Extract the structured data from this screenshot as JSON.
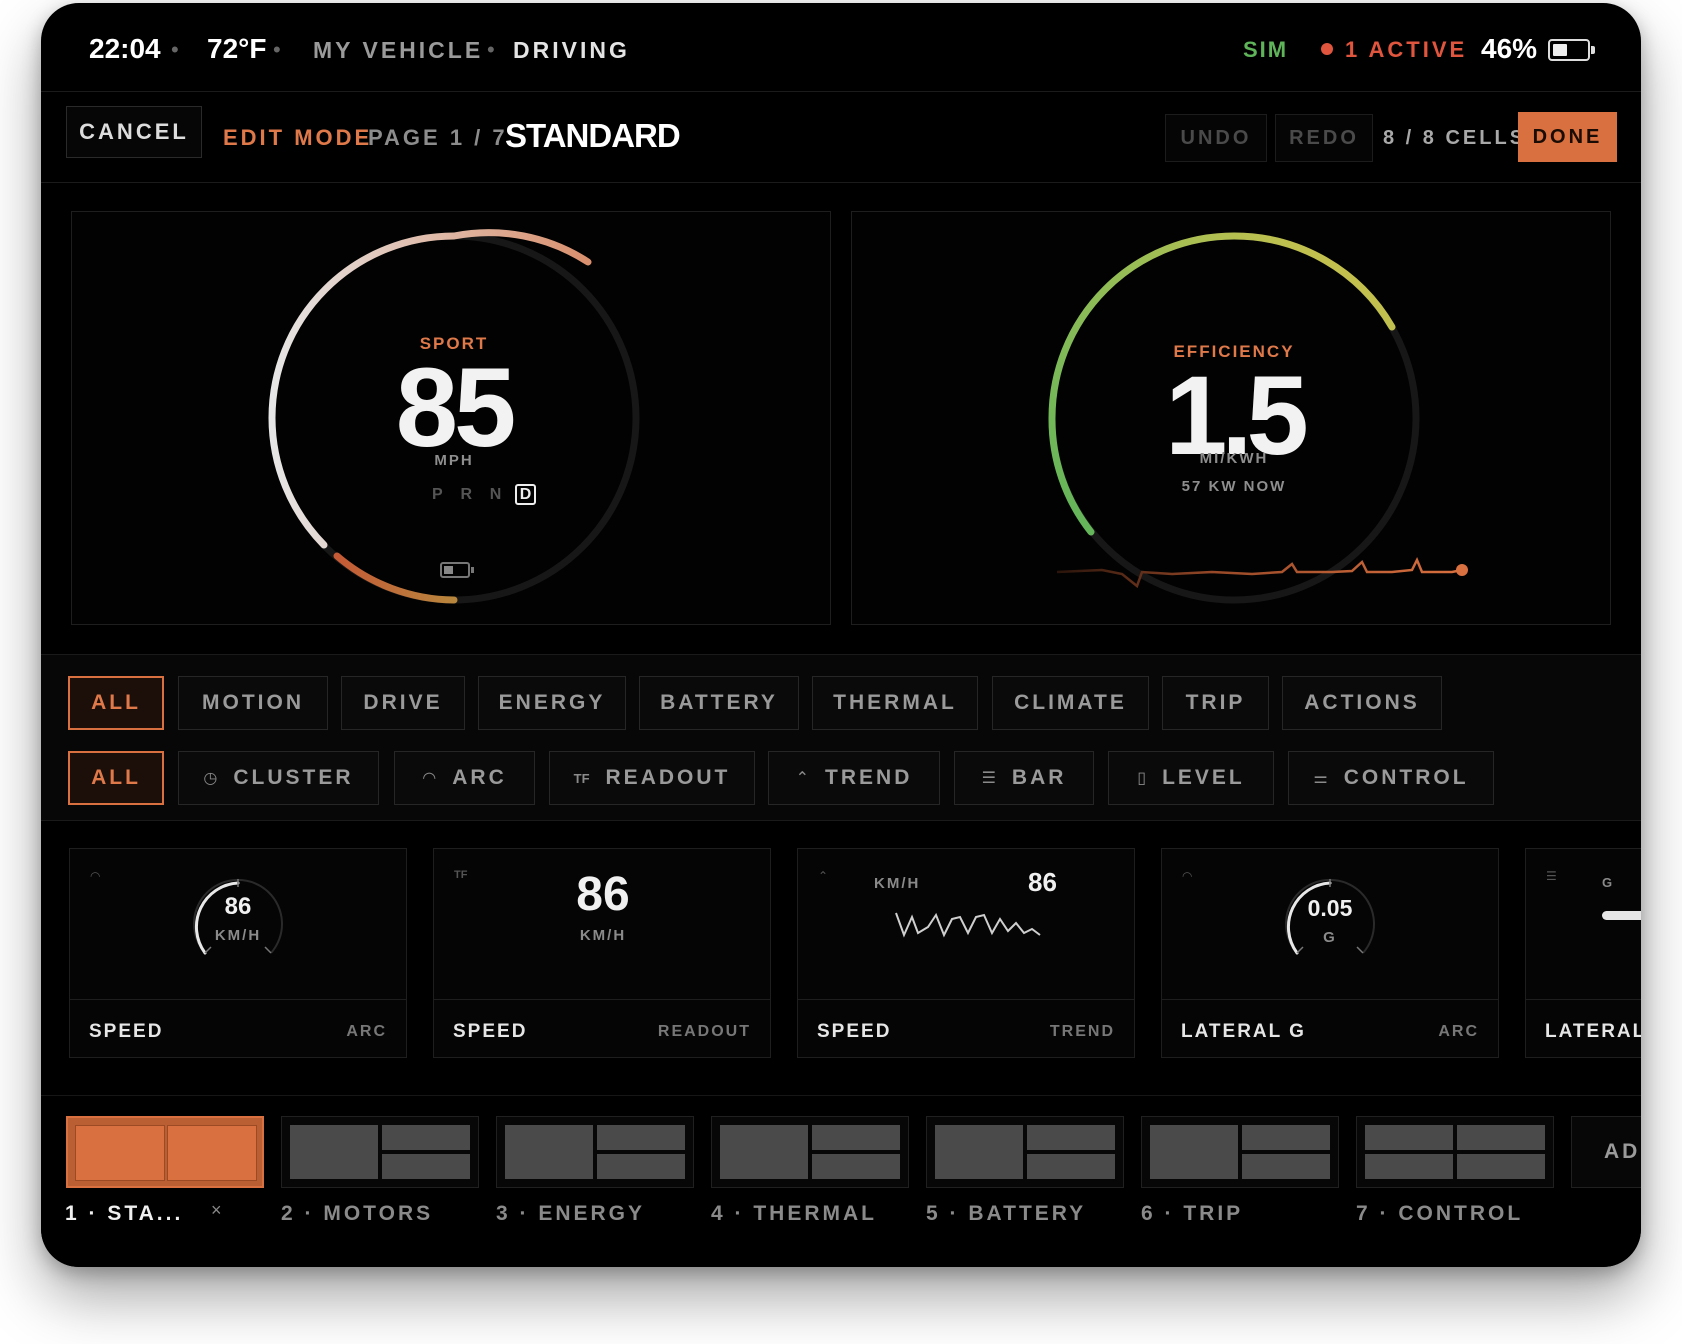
{
  "status_bar": {
    "time": "22:04",
    "temperature": "72°F",
    "vehicle": "MY VEHICLE",
    "mode": "DRIVING",
    "sim": "SIM",
    "active": "1 ACTIVE",
    "battery": "46%",
    "battery_level": 0.46
  },
  "toolbar": {
    "cancel_label": "CANCEL",
    "edit_mode_label": "EDIT MODE",
    "page_indicator": "PAGE 1 / 7",
    "page_name": "STANDARD",
    "undo_label": "UNDO",
    "redo_label": "REDO",
    "cells_count": "8 / 8 CELLS",
    "done_label": "DONE"
  },
  "speed_gauge": {
    "mode": "SPORT",
    "value": "85",
    "unit": "MPH",
    "gears": [
      "P",
      "R",
      "N",
      "D"
    ],
    "active_gear": "D"
  },
  "efficiency_gauge": {
    "label": "EFFICIENCY",
    "value": "1.5",
    "unit": "MI/KWH",
    "sub": "57 KW NOW"
  },
  "category_filters": [
    "ALL",
    "MOTION",
    "DRIVE",
    "ENERGY",
    "BATTERY",
    "THERMAL",
    "CLIMATE",
    "TRIP",
    "ACTIONS"
  ],
  "type_filters": [
    {
      "label": "ALL",
      "icon": ""
    },
    {
      "label": "CLUSTER",
      "icon": "clock-icon"
    },
    {
      "label": "ARC",
      "icon": "arc-icon"
    },
    {
      "label": "READOUT",
      "icon": "readout-icon"
    },
    {
      "label": "TREND",
      "icon": "trend-icon"
    },
    {
      "label": "BAR",
      "icon": "bar-icon"
    },
    {
      "label": "LEVEL",
      "icon": "level-icon"
    },
    {
      "label": "CONTROL",
      "icon": "control-icon"
    }
  ],
  "widgets": [
    {
      "name": "SPEED",
      "type": "ARC",
      "value": "86",
      "unit": "KM/H"
    },
    {
      "name": "SPEED",
      "type": "READOUT",
      "value": "86",
      "unit": "KM/H"
    },
    {
      "name": "SPEED",
      "type": "TREND",
      "value": "86",
      "unit": "KM/H"
    },
    {
      "name": "LATERAL G",
      "type": "ARC",
      "value": "0.05",
      "unit": "G"
    },
    {
      "name": "LATERAL",
      "type": "",
      "value": "",
      "unit": "G"
    }
  ],
  "pages": [
    {
      "label": "1 · STA...",
      "close": "×"
    },
    {
      "label": "2 · MOTORS"
    },
    {
      "label": "3 · ENERGY"
    },
    {
      "label": "4 · THERMAL"
    },
    {
      "label": "5 · BATTERY"
    },
    {
      "label": "6 · TRIP"
    },
    {
      "label": "7 · CONTROL"
    }
  ],
  "add_page_label": "ADD",
  "colors": {
    "accent": "#d9703f",
    "green": "#5fb45a",
    "alert": "#e0553e"
  }
}
